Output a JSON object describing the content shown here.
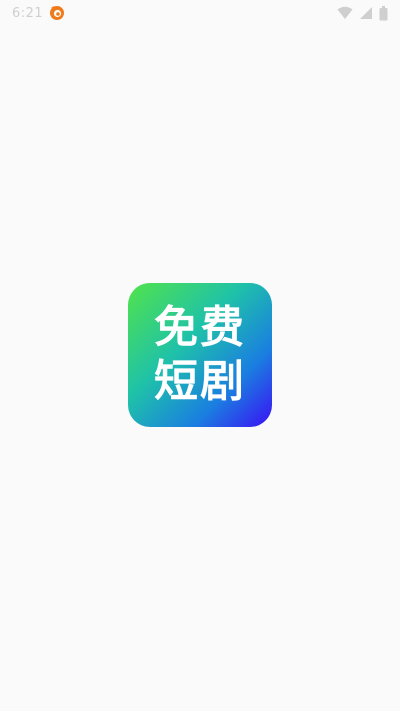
{
  "status_bar": {
    "time": "6:21",
    "icons": [
      "notification-swirl-icon",
      "wifi-icon",
      "signal-icon",
      "battery-icon"
    ]
  },
  "app": {
    "logo_line_1": "免费",
    "logo_line_2": "短剧"
  },
  "colors": {
    "background": "#fafafa",
    "logo_gradient_start": "#52e34a",
    "logo_gradient_mid": "#1fc2a8",
    "logo_gradient_end": "#3a10f5",
    "logo_text": "#ffffff",
    "status_icons": "#cfcfcf",
    "notification_accent": "#f07a1a"
  }
}
